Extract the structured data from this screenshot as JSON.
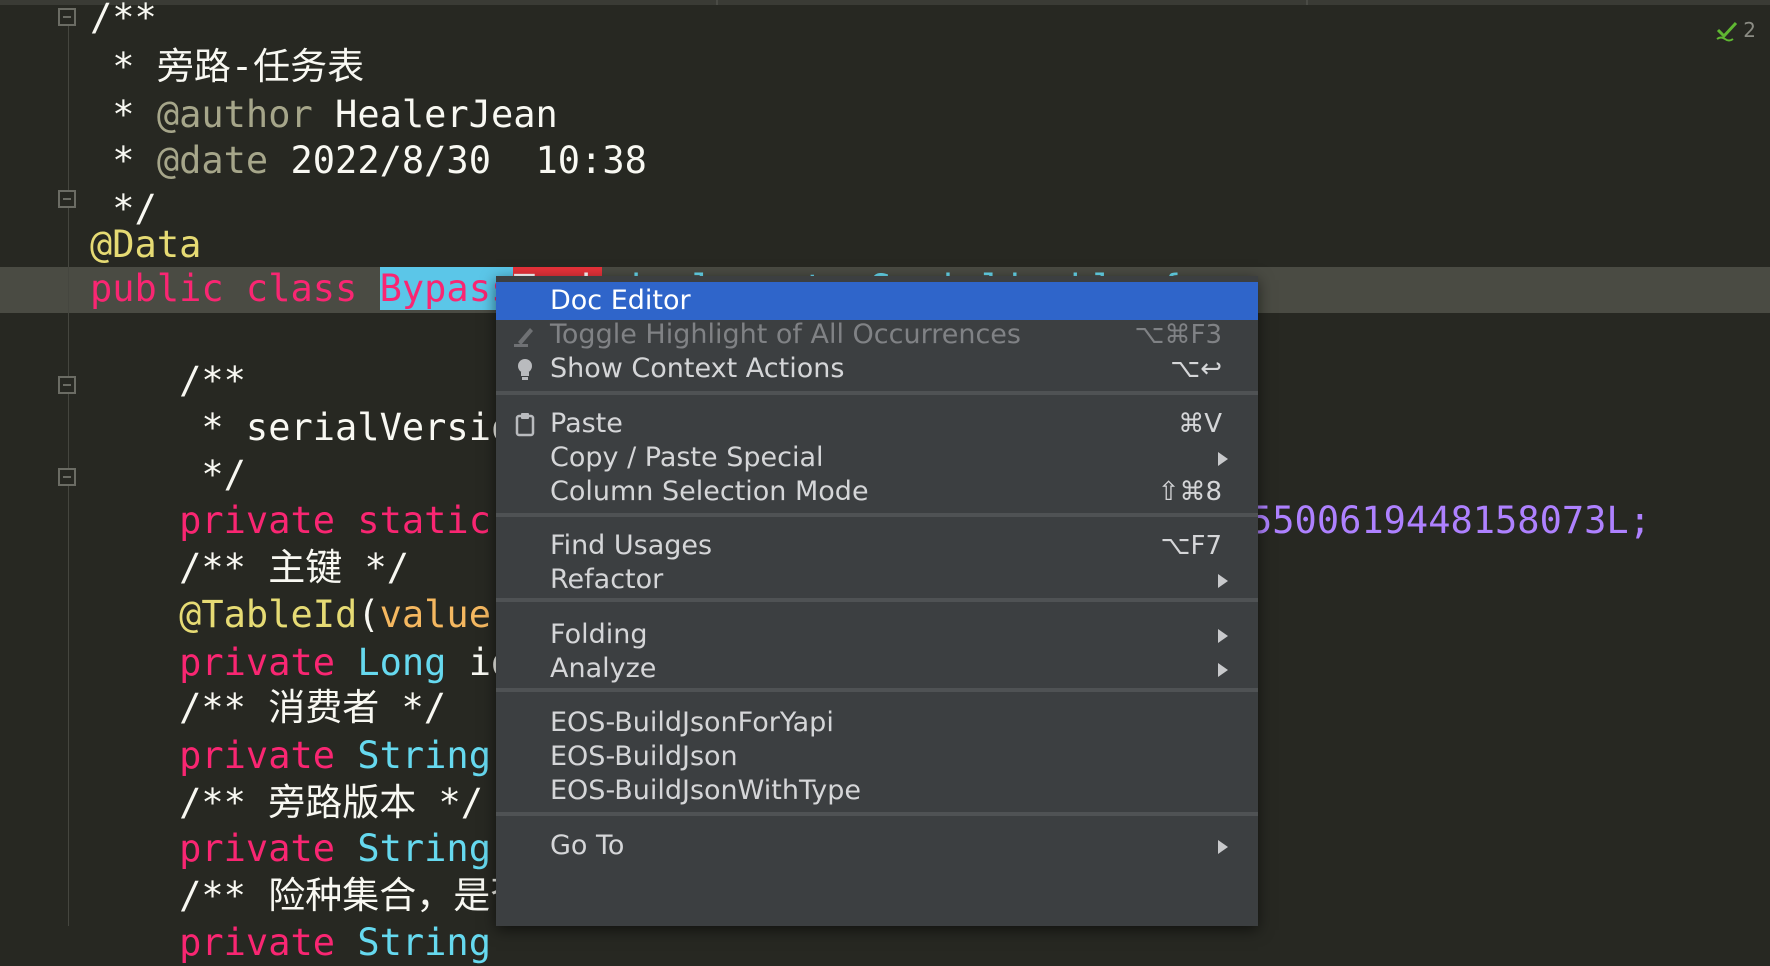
{
  "editor": {
    "lines": [
      {
        "parts": [
          {
            "t": "/**",
            "c": "c-com"
          }
        ]
      },
      {
        "parts": [
          {
            "t": " * 旁路-任务表",
            "c": "c-com"
          }
        ]
      },
      {
        "parts": [
          {
            "t": " * ",
            "c": "c-com"
          },
          {
            "t": "@author",
            "c": "c-tag"
          },
          {
            "t": " HealerJean",
            "c": "c-com"
          }
        ]
      },
      {
        "parts": [
          {
            "t": " * ",
            "c": "c-com"
          },
          {
            "t": "@date",
            "c": "c-tag"
          },
          {
            "t": " 2022/8/30  10:38",
            "c": "c-com"
          }
        ]
      },
      {
        "parts": [
          {
            "t": " */",
            "c": "c-com"
          }
        ]
      },
      {
        "parts": [
          {
            "t": "@Data",
            "c": "c-ann"
          }
        ]
      },
      {
        "parts": [
          {
            "t": "public class ",
            "c": "c-kw"
          }
        ]
      },
      {
        "parts": []
      },
      {
        "parts": [
          {
            "t": "    /**",
            "c": "c-com"
          }
        ]
      },
      {
        "parts": [
          {
            "t": "     * serialVersio",
            "c": "c-com"
          }
        ]
      },
      {
        "parts": [
          {
            "t": "     */",
            "c": "c-com"
          }
        ]
      },
      {
        "parts": [
          {
            "t": "    private static ",
            "c": "c-kw"
          }
        ]
      },
      {
        "parts": [
          {
            "t": "    /** 主键 */",
            "c": "c-com"
          }
        ]
      },
      {
        "parts": [
          {
            "t": "    ",
            "c": "c-com"
          },
          {
            "t": "@TableId",
            "c": "c-ann"
          },
          {
            "t": "(",
            "c": "c-paren"
          },
          {
            "t": "value",
            "c": "c-param"
          }
        ]
      },
      {
        "parts": [
          {
            "t": "    private ",
            "c": "c-kw"
          },
          {
            "t": "Long",
            "c": "c-type"
          },
          {
            "t": " id",
            "c": "c-com"
          }
        ]
      },
      {
        "parts": [
          {
            "t": "    /** 消费者 */",
            "c": "c-com"
          }
        ]
      },
      {
        "parts": [
          {
            "t": "    private ",
            "c": "c-kw"
          },
          {
            "t": "String",
            "c": "c-type"
          }
        ]
      },
      {
        "parts": [
          {
            "t": "    /** 旁路版本 */",
            "c": "c-com"
          }
        ]
      },
      {
        "parts": [
          {
            "t": "    private ",
            "c": "c-kw"
          },
          {
            "t": "String",
            "c": "c-type"
          }
        ]
      },
      {
        "parts": [
          {
            "t": "    /** 险种集合，是否",
            "c": "c-com"
          }
        ]
      },
      {
        "parts": [
          {
            "t": "    private ",
            "c": "c-kw"
          },
          {
            "t": "String",
            "c": "c-type"
          }
        ]
      }
    ],
    "class_name_selected": "Bypass",
    "class_name_rest": "Task",
    "class_tail": " implements Serializable {",
    "serial_value_tail": "5500619448158073L;",
    "inspection_count": "2"
  },
  "context_menu": {
    "items": [
      {
        "label": "Doc Editor",
        "shortcut": "",
        "submenu": false,
        "state": "active",
        "icon": ""
      },
      {
        "label": "Toggle Highlight of All Occurrences",
        "shortcut": "⌥⌘F3",
        "submenu": false,
        "state": "disabled",
        "icon": "highlighter-icon"
      },
      {
        "label": "Show Context Actions",
        "shortcut": "⌥↩",
        "submenu": false,
        "state": "normal",
        "icon": "lightbulb-icon"
      },
      {
        "sep": true
      },
      {
        "label": "Paste",
        "shortcut": "⌘V",
        "submenu": false,
        "state": "normal",
        "icon": "clipboard-icon"
      },
      {
        "label": "Copy / Paste Special",
        "shortcut": "",
        "submenu": true,
        "state": "normal",
        "icon": ""
      },
      {
        "label": "Column Selection Mode",
        "shortcut": "⇧⌘8",
        "submenu": false,
        "state": "normal",
        "icon": ""
      },
      {
        "sep": true
      },
      {
        "label": "Find Usages",
        "shortcut": "⌥F7",
        "submenu": false,
        "state": "normal",
        "icon": ""
      },
      {
        "label": "Refactor",
        "shortcut": "",
        "submenu": true,
        "state": "normal",
        "icon": ""
      },
      {
        "sep": true
      },
      {
        "label": "Folding",
        "shortcut": "",
        "submenu": true,
        "state": "normal",
        "icon": ""
      },
      {
        "label": "Analyze",
        "shortcut": "",
        "submenu": true,
        "state": "normal",
        "icon": ""
      },
      {
        "sep": true
      },
      {
        "label": "EOS-BuildJsonForYapi",
        "shortcut": "",
        "submenu": false,
        "state": "normal",
        "icon": ""
      },
      {
        "label": "EOS-BuildJson",
        "shortcut": "",
        "submenu": false,
        "state": "normal",
        "icon": ""
      },
      {
        "label": "EOS-BuildJsonWithType",
        "shortcut": "",
        "submenu": false,
        "state": "normal",
        "icon": ""
      },
      {
        "sep": true
      },
      {
        "label": "Go To",
        "shortcut": "",
        "submenu": true,
        "state": "normal",
        "icon": ""
      }
    ]
  },
  "colors": {
    "background": "#272822",
    "menu_bg": "#3c3f41",
    "menu_active": "#2f65ca",
    "keyword": "#f92672",
    "type": "#66d9ef",
    "annotation": "#e6db74",
    "number": "#ae81ff"
  }
}
